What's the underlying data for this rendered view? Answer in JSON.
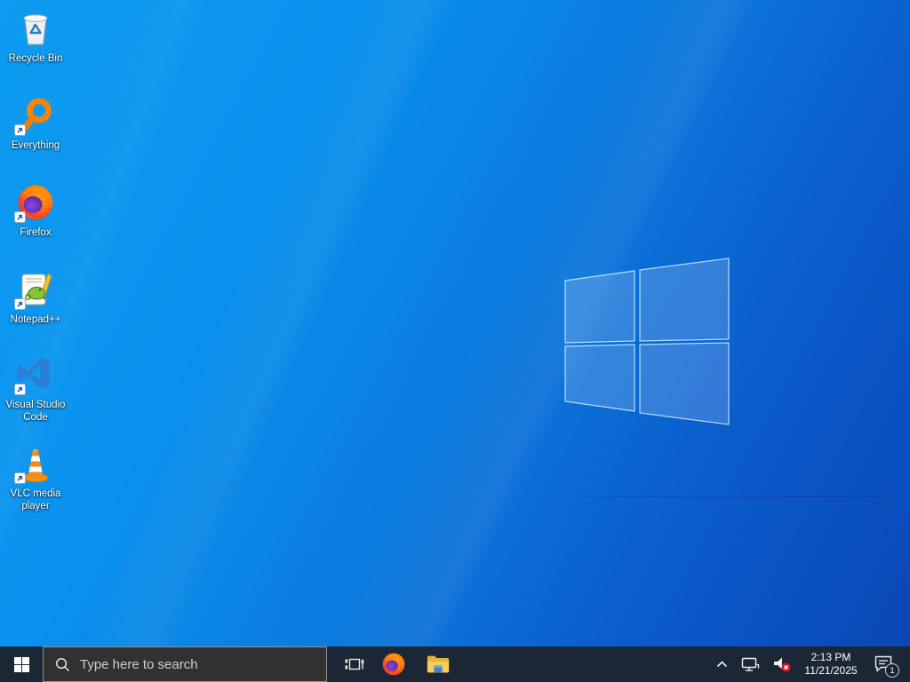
{
  "wallpaper": {
    "top_color": "#0d9cf2",
    "bottom_color": "#0a46b6",
    "logo": "windows-flag"
  },
  "desktop": {
    "icons": [
      {
        "name": "recycle-bin",
        "label": "Recycle Bin",
        "icon": "recycle-bin-icon",
        "shortcut_badge": false
      },
      {
        "name": "everything",
        "label": "Everything",
        "icon": "orange-magnifier-icon",
        "shortcut_badge": true
      },
      {
        "name": "firefox",
        "label": "Firefox",
        "icon": "firefox-icon",
        "shortcut_badge": true
      },
      {
        "name": "notepad-plus-plus",
        "label": "Notepad++",
        "icon": "notepad-icon",
        "shortcut_badge": true
      },
      {
        "name": "visual-studio-code",
        "label": "Visual Studio Code",
        "icon": "vscode-icon",
        "shortcut_badge": true
      },
      {
        "name": "vlc-media-player",
        "label": "VLC media player",
        "icon": "traffic-cone-icon",
        "shortcut_badge": true
      }
    ]
  },
  "taskbar": {
    "background": "#1c2735",
    "buttons": [
      {
        "name": "start",
        "icon": "windows-logo-icon"
      },
      {
        "name": "task-view",
        "icon": "task-view-icon"
      },
      {
        "name": "firefox",
        "icon": "firefox-icon"
      },
      {
        "name": "file-explorer",
        "icon": "folder-icon"
      }
    ],
    "search": {
      "placeholder": "Type here to search",
      "icon": "search-icon"
    },
    "tray": {
      "icons": [
        "chevron-up-icon",
        "network-icon",
        "volume-muted-icon"
      ],
      "time": "2:13 PM",
      "date": "11/21/2025",
      "notification_count": "1"
    }
  }
}
